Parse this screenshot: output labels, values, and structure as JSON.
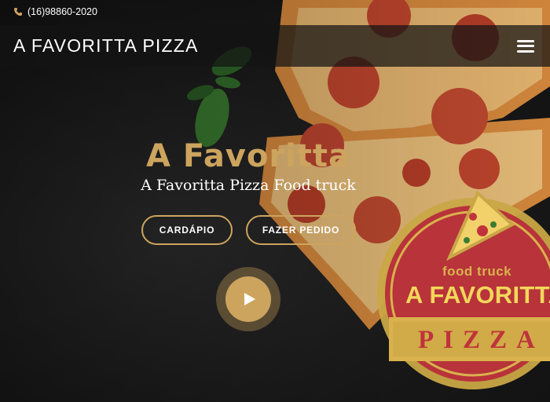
{
  "topbar": {
    "phone": "(16)98860-2020",
    "icon": "phone-icon"
  },
  "header": {
    "brand": "A FAVORITTA PIZZA",
    "menu_icon": "hamburger-menu-icon"
  },
  "hero": {
    "title": "A Favoritta",
    "subtitle": "A Favoritta Pizza Food truck",
    "buttons": {
      "menu_label": "CARDÁPIO",
      "order_label": "FAZER PEDIDO"
    },
    "play_icon": "play-icon"
  },
  "logo": {
    "tagline": "food truck",
    "name": "A FAVORITTA",
    "word": "PIZZA"
  },
  "colors": {
    "accent": "#cda45e",
    "logo_red": "#c0333b",
    "logo_gold": "#d9b24d",
    "header_bg": "#141414"
  }
}
